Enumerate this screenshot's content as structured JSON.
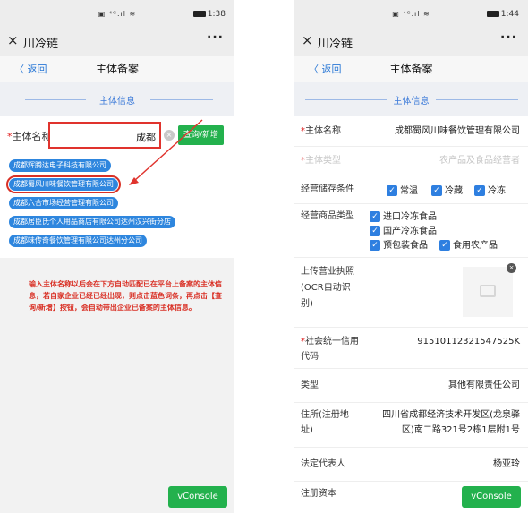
{
  "left": {
    "status": {
      "signal": "▣ ⁴ᴳ.ıl ≋",
      "time": "1:38"
    },
    "app": {
      "close": "×",
      "title": "川冷链",
      "more": "···"
    },
    "nav": {
      "back": "〈 返回",
      "title": "主体备案"
    },
    "section": {
      "title": "主体信息"
    },
    "form": {
      "label": "主体名称",
      "input_value": "成都",
      "clear": "×",
      "query_button": "查询/新增"
    },
    "suggestions": [
      "成都辉腾达电子科技有限公司",
      "成都蜀风川味餐饮管理有限公司",
      "成都六合市场经营管理有限公司",
      "成都居臣氏个人用品商店有限公司达州汉兴街分店",
      "成都味传奇餐饮管理有限公司达州分公司"
    ],
    "note": "输入主体名称以后会在下方自动匹配已在平台上备案的主体信息，若自家企业已经已经出现，则点击蓝色词条，再点击【查询/新增】按钮，会自动带出企业已备案的主体信息。",
    "vconsole": "vConsole"
  },
  "right": {
    "status": {
      "signal": "▣ ⁴ᴳ.ıl ≋",
      "time": "1:44"
    },
    "app": {
      "close": "×",
      "title": "川冷链",
      "more": "···"
    },
    "nav": {
      "back": "〈 返回",
      "title": "主体备案"
    },
    "section": {
      "title": "主体信息"
    },
    "fields": {
      "name_label": "主体名称",
      "name_value": "成都蜀风川味餐饮管理有限公司",
      "type_label": "主体类型",
      "type_placeholder": "农产品及食品经营者",
      "storage_label": "经营储存条件",
      "storage_options": [
        "常温",
        "冷藏",
        "冷冻"
      ],
      "goods_label": "经营商品类型",
      "goods_options": [
        "进口冷冻食品",
        "国产冷冻食品",
        "预包装食品",
        "食用农产品"
      ],
      "license_label_1": "上传营业执照",
      "license_label_2": "(OCR自动识",
      "license_label_3": "别)",
      "credit_label_1": "社会统一信用",
      "credit_label_2": "代码",
      "credit_value": "91510112321547525K",
      "kind_label": "类型",
      "kind_value": "其他有限责任公司",
      "addr_label_1": "住所(注册地",
      "addr_label_2": "址)",
      "addr_value_1": "四川省成都经济技术开发区(龙泉驿",
      "addr_value_2": "区)南二路321号2栋1层附1号",
      "rep_label": "法定代表人",
      "rep_value": "杨亚玲",
      "capital_label": "注册资本"
    },
    "check": "✓",
    "vconsole": "vConsole"
  },
  "colors": {
    "accent_blue": "#2e86de",
    "highlight_red": "#e0332d",
    "green": "#23b14d"
  }
}
